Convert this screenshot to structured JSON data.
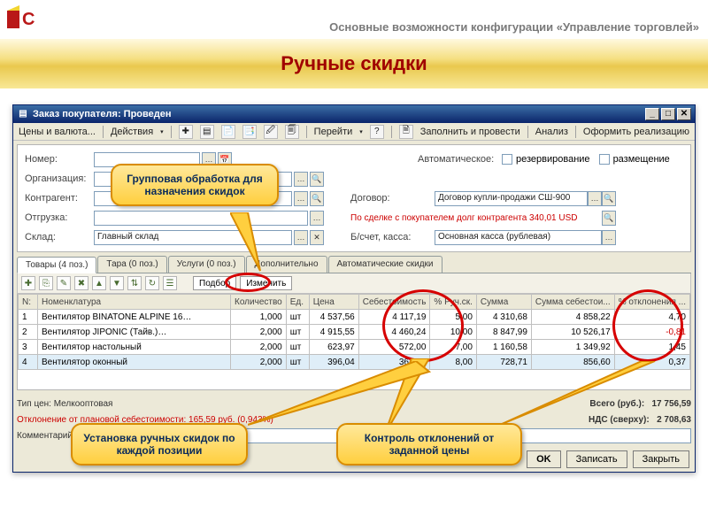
{
  "slide": {
    "config_title": "Основные возможности конфигурации «Управление торговлей»",
    "title": "Ручные скидки"
  },
  "window": {
    "title": "Заказ покупателя: Проведен"
  },
  "toolbar": {
    "prices": "Цены и валюта...",
    "actions": "Действия",
    "go": "Перейти",
    "fill": "Заполнить и провести",
    "analysis": "Анализ",
    "realize": "Оформить реализацию"
  },
  "form": {
    "label_number": "Номер:",
    "label_org": "Организация:",
    "label_counterparty": "Контрагент:",
    "label_shipment": "Отгрузка:",
    "label_warehouse": "Склад:",
    "warehouse_value": "Главный склад",
    "label_auto": "Автоматическое:",
    "chk_reserve": "резервирование",
    "chk_place": "размещение",
    "label_contract": "Договор:",
    "contract_value": "Договор купли-продажи СШ-900",
    "debt_note": "По сделке с покупателем долг контрагента 340,01 USD",
    "label_account": "Б/счет, касса:",
    "account_value": "Основная касса (рублевая)"
  },
  "tabs": {
    "goods": "Товары (4 поз.)",
    "tare": "Тара (0 поз.)",
    "services": "Услуги (0 поз.)",
    "extra": "Дополнительно",
    "auto": "Автоматические скидки"
  },
  "tb2": {
    "select": "Подбор",
    "change": "Изменить"
  },
  "cols": {
    "n": "N:",
    "name": "Номенклатура",
    "qty": "Количество",
    "unit": "Ед.",
    "price": "Цена",
    "cost": "Себестоимость",
    "man": "% Руч.ск.",
    "sum": "Сумма",
    "sumcost": "Сумма себестои...",
    "dev": "% отклонения ..."
  },
  "rows": [
    {
      "n": "1",
      "name": "Вентилятор BINATONE ALPINE 16…",
      "qty": "1,000",
      "unit": "шт",
      "price": "4 537,56",
      "cost": "4 117,19",
      "man": "5,00",
      "sum": "4 310,68",
      "sumcost": "4 858,22",
      "dev": "4,70"
    },
    {
      "n": "2",
      "name": "Вентилятор JIPONIC (Тайв.)…",
      "qty": "2,000",
      "unit": "шт",
      "price": "4 915,55",
      "cost": "4 460,24",
      "man": "10,00",
      "sum": "8 847,99",
      "sumcost": "10 526,17",
      "dev": "-0,81"
    },
    {
      "n": "3",
      "name": "Вентилятор настольный",
      "qty": "2,000",
      "unit": "шт",
      "price": "623,97",
      "cost": "572,00",
      "man": "7,00",
      "sum": "1 160,58",
      "sumcost": "1 349,92",
      "dev": "1,45"
    },
    {
      "n": "4",
      "name": "Вентилятор оконный",
      "qty": "2,000",
      "unit": "шт",
      "price": "396,04",
      "cost": "363,05",
      "man": "8,00",
      "sum": "728,71",
      "sumcost": "856,60",
      "dev": "0,37"
    }
  ],
  "footer": {
    "pricetype": "Тип цен: Мелкооптовая",
    "total_lbl": "Всего (руб.):",
    "total_val": "17 756,59",
    "deviation": "Отклонение от плановой себестоимости: 165,59 руб. (0,943%)",
    "vat_lbl": "НДС (сверху):",
    "vat_val": "2 708,63",
    "comment": "Комментарий:"
  },
  "buttons": {
    "ok": "OK",
    "save": "Записать",
    "close": "Закрыть"
  },
  "callouts": {
    "c1": "Групповая обработка для назначения скидок",
    "c2": "Установка ручных скидок по каждой позиции",
    "c3": "Контроль отклонений от заданной цены"
  }
}
